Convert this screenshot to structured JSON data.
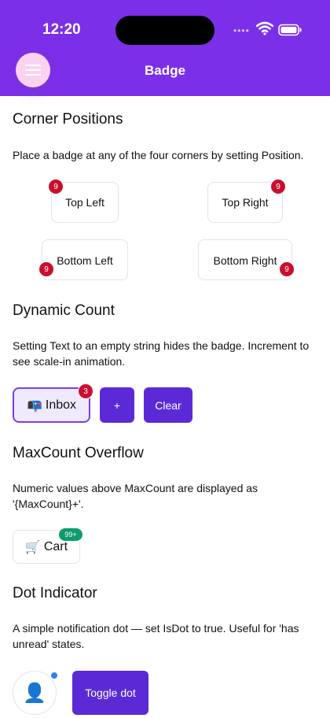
{
  "status_bar": {
    "time": "12:20",
    "signal_dots": "••••"
  },
  "header": {
    "title": "Badge",
    "menu_icon": "hamburger-icon",
    "bg_color": "#7c2fe8"
  },
  "corner_positions": {
    "heading": "Corner Positions",
    "description": "Place a badge at any of the four corners by setting Position.",
    "items": [
      {
        "label": "Top Left",
        "badge": "9"
      },
      {
        "label": "Top Right",
        "badge": "9"
      },
      {
        "label": "Bottom Left",
        "badge": "9"
      },
      {
        "label": "Bottom Right",
        "badge": "9"
      }
    ],
    "badge_color": "#c8102e"
  },
  "dynamic_count": {
    "heading": "Dynamic Count",
    "description": "Setting Text to an empty string hides the badge. Increment to see scale-in animation.",
    "inbox_icon": "📭",
    "inbox_label": "Inbox",
    "inbox_badge": "3",
    "increment_label": "+",
    "clear_label": "Clear"
  },
  "max_count": {
    "heading": "MaxCount Overflow",
    "description": "Numeric values above MaxCount are displayed as '{MaxCount}+'.",
    "cart_icon": "🛒",
    "cart_label": "Cart",
    "cart_badge": "99+",
    "badge_color": "#0e9b6d"
  },
  "dot_indicator": {
    "heading": "Dot Indicator",
    "description": "A simple notification dot — set IsDot to true. Useful for 'has unread' states.",
    "avatar_icon": "👤",
    "toggle_label": "Toggle dot",
    "dot_color": "#2f7cf6"
  }
}
